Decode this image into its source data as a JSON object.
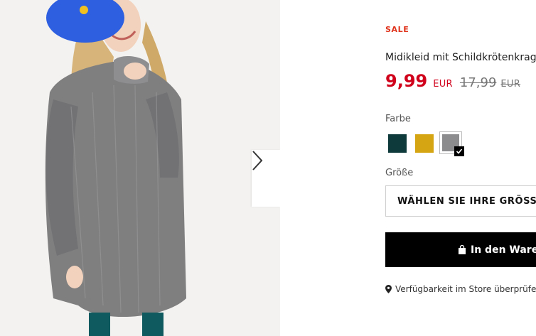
{
  "gallery": {
    "image_alt_icon": "product-photo-girl-in-grey-dress",
    "next_icon": "chevron-right-icon"
  },
  "product": {
    "badge": "SALE",
    "title": "Midikleid mit Schildkrötenkragen",
    "price_current": "9,99",
    "price_current_currency": "EUR",
    "price_old": "17,99",
    "price_old_currency": "EUR",
    "price_color": "#d0021b",
    "badge_color": "#e0351e"
  },
  "color_selector": {
    "label": "Farbe",
    "options": [
      {
        "name": "dark-teal",
        "hex": "#0f3a3b",
        "selected": false
      },
      {
        "name": "mustard",
        "hex": "#d6a514",
        "selected": false
      },
      {
        "name": "grey",
        "hex": "#8c8c8e",
        "selected": true
      }
    ]
  },
  "size_selector": {
    "label": "Größe",
    "value": "WÄHLEN SIE IHRE GRÖSSE"
  },
  "cart_button": {
    "label": "In den Warenkorb",
    "icon": "shopping-bag-icon"
  },
  "store_availability": {
    "label": "Verfügbarkeit im Store überprüfen",
    "icon": "location-pin-icon"
  }
}
